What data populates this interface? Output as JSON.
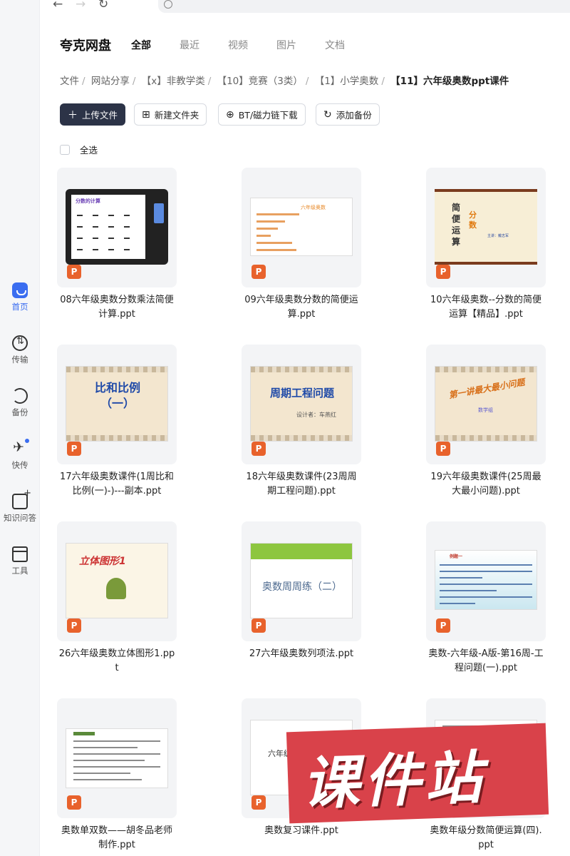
{
  "app": {
    "title": "夸克网盘"
  },
  "tabs": [
    "全部",
    "最近",
    "视频",
    "图片",
    "文档"
  ],
  "rail": [
    "首页",
    "传输",
    "备份",
    "快传",
    "知识问答",
    "工具"
  ],
  "breadcrumb": [
    "文件",
    "网站分享",
    "【x】非教学类",
    "【10】竞赛（3类）",
    "【1】小学奥数",
    "【11】六年级奥数ppt课件"
  ],
  "toolbar": {
    "upload": "上传文件",
    "new_folder": "新建文件夹",
    "bt": "BT/磁力链下载",
    "backup": "添加备份"
  },
  "select_all": "全选",
  "files": [
    "08六年级奥数分数乘法简便计算.ppt",
    "09六年级奥数分数的简便运算.ppt",
    "10六年级奥数--分数的简便运算【精品】.ppt",
    "17六年级奥数课件(1周比和比例(一)-)---副本.ppt",
    "18六年级奥数课件(23周周期工程问题).ppt",
    "19六年级奥数课件(25周最大最小问题).ppt",
    "26六年级奥数立体图形1.ppt",
    "27六年级奥数列项法.ppt",
    "奥数-六年级-A版-第16周-工程问题(一).ppt",
    "奥数单双数——胡冬品老师制作.ppt",
    "奥数复习课件.ppt",
    "奥数年级分数简便运算(四).ppt"
  ],
  "slides": {
    "s1_title": "分数的计算",
    "s2_title": "六年级奥数",
    "s3_vertical": "简便运算",
    "s3_orange": "分数",
    "s3_author": "主讲：戴志军",
    "s4_line1": "比和比例",
    "s4_line2": "（一）",
    "s5_title": "周期工程问题",
    "s5_sub": "设计者：车燕红",
    "s6_title": "第一讲最大最小问题",
    "s6_sub": "数学组",
    "s7_title": "立体图形1",
    "s8_title": "奥数周周练（二）",
    "s9_title": "例题一",
    "s11_title": "六年级奥数综合复习"
  },
  "watermark": "课件站",
  "colors": {
    "accent": "#3a6df0",
    "primary_btn": "#2c3347",
    "ppt": "#e8622c",
    "watermark": "#d9424a"
  }
}
